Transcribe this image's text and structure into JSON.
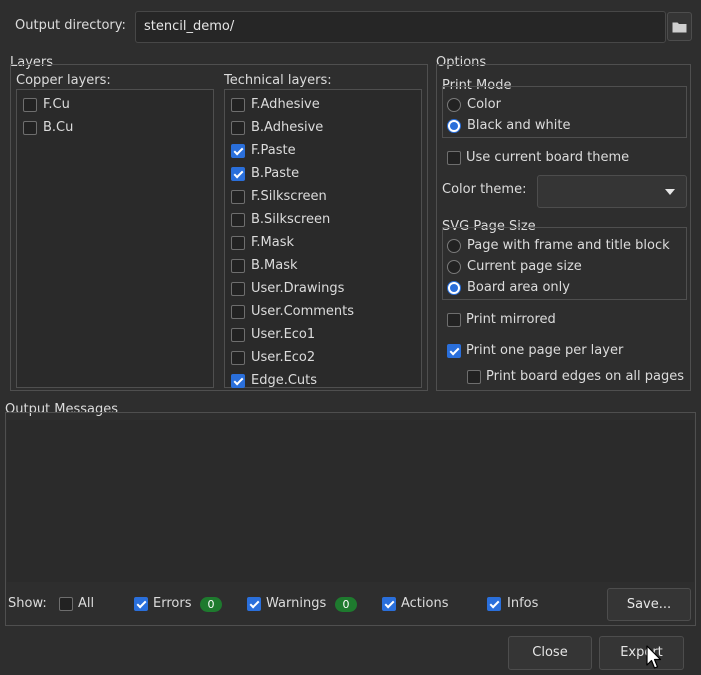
{
  "output_dir": {
    "label": "Output directory:",
    "value": "stencil_demo/",
    "browse_icon": "folder-icon"
  },
  "layers": {
    "title": "Layers",
    "copper_title": "Copper layers:",
    "technical_title": "Technical layers:",
    "copper": [
      {
        "label": "F.Cu",
        "checked": false
      },
      {
        "label": "B.Cu",
        "checked": false
      }
    ],
    "technical": [
      {
        "label": "F.Adhesive",
        "checked": false
      },
      {
        "label": "B.Adhesive",
        "checked": false
      },
      {
        "label": "F.Paste",
        "checked": true
      },
      {
        "label": "B.Paste",
        "checked": true
      },
      {
        "label": "F.Silkscreen",
        "checked": false
      },
      {
        "label": "B.Silkscreen",
        "checked": false
      },
      {
        "label": "F.Mask",
        "checked": false
      },
      {
        "label": "B.Mask",
        "checked": false
      },
      {
        "label": "User.Drawings",
        "checked": false
      },
      {
        "label": "User.Comments",
        "checked": false
      },
      {
        "label": "User.Eco1",
        "checked": false
      },
      {
        "label": "User.Eco2",
        "checked": false
      },
      {
        "label": "Edge.Cuts",
        "checked": true
      }
    ]
  },
  "options": {
    "title": "Options",
    "print_mode": {
      "title": "Print Mode",
      "color": {
        "label": "Color",
        "selected": false
      },
      "bw": {
        "label": "Black and white",
        "selected": true
      }
    },
    "use_theme": {
      "label": "Use current board theme",
      "checked": false
    },
    "color_theme": {
      "label": "Color theme:",
      "value": ""
    },
    "svg_page_size": {
      "title": "SVG Page Size",
      "frame": {
        "label": "Page with frame and title block",
        "selected": false
      },
      "current": {
        "label": "Current page size",
        "selected": false
      },
      "board": {
        "label": "Board area only",
        "selected": true
      }
    },
    "mirrored": {
      "label": "Print mirrored",
      "checked": false
    },
    "one_page": {
      "label": "Print one page per layer",
      "checked": true
    },
    "edges_all": {
      "label": "Print board edges on all pages",
      "checked": false
    }
  },
  "messages": {
    "title": "Output Messages",
    "show_label": "Show:",
    "all": {
      "label": "All",
      "checked": false
    },
    "errors": {
      "label": "Errors",
      "count": "0",
      "checked": true
    },
    "warnings": {
      "label": "Warnings",
      "count": "0",
      "checked": true
    },
    "actions": {
      "label": "Actions",
      "checked": true
    },
    "infos": {
      "label": "Infos",
      "checked": true
    },
    "save_label": "Save..."
  },
  "footer": {
    "close_label": "Close",
    "export_label": "Export"
  },
  "colors": {
    "accent": "#2a6fdb",
    "badge": "#1e7a2e",
    "background": "#2e2e2e"
  }
}
